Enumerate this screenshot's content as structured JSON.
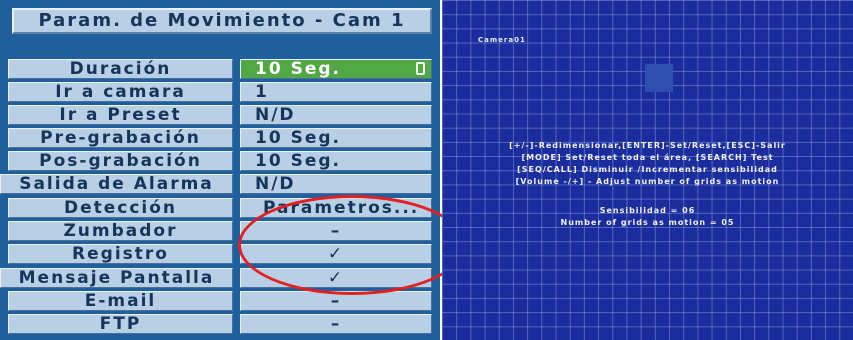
{
  "menu": {
    "title": "Param. de Movimiento - Cam 1",
    "rows": [
      {
        "label": "Duración",
        "value": "10 Seg."
      },
      {
        "label": "Ir a camara",
        "value": "1"
      },
      {
        "label": "Ir a Preset",
        "value": "N/D"
      },
      {
        "label": "Pre-grabación",
        "value": "10 Seg."
      },
      {
        "label": "Pos-grabación",
        "value": "10 Seg."
      },
      {
        "label": "Salida de Alarma",
        "value": "N/D"
      },
      {
        "label": "Detección",
        "value": "Parametros..."
      },
      {
        "label": "Zumbador",
        "value": "–"
      },
      {
        "label": "Registro",
        "value": "✓"
      },
      {
        "label": "Mensaje Pantalla",
        "value": "✓"
      },
      {
        "label": "E-mail",
        "value": "–"
      },
      {
        "label": "FTP",
        "value": "–"
      }
    ]
  },
  "camera": {
    "label": "Camera01",
    "help_lines": [
      "[+/-]-Redimensionar,[ENTER]-Set/Reset,[ESC]-Salir",
      "[MODE] Set/Reset toda el área, [SEARCH] Test",
      "[SEQ/CALL] Disminuir /Incrementar sensibilidad",
      "[Volume -/+] - Adjust number of grids as motion"
    ],
    "sensitivity": "Sensibilidad = 06",
    "grids": "Number of grids as motion = 05"
  },
  "colors": {
    "menu_bg": "#1f5f9e",
    "field_bg": "#b9cfe6",
    "selected_bg": "#53a846",
    "camera_bg": "#1b2d9c",
    "annotation": "#e32020"
  }
}
